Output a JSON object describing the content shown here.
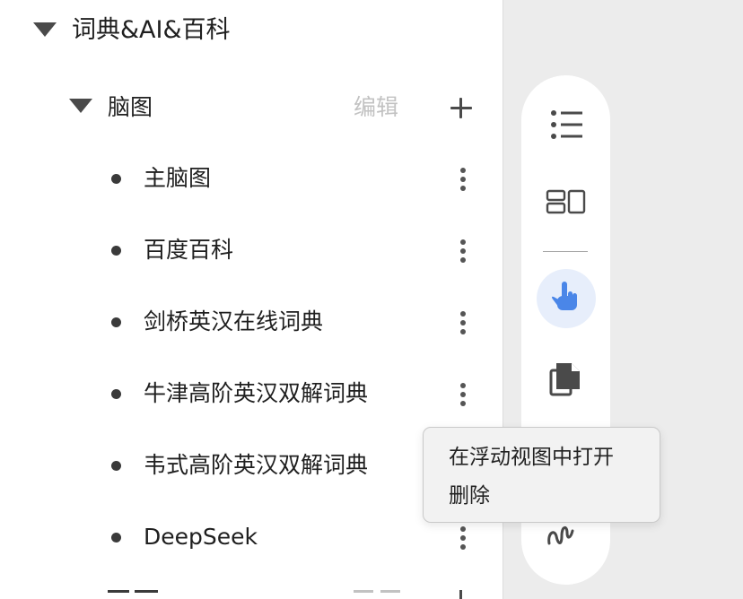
{
  "sidebar": {
    "group": {
      "title": "词典&AI&百科",
      "expanded": true
    },
    "subgroup": {
      "title": "脑图",
      "edit_label": "编辑",
      "expanded": true
    },
    "items": [
      {
        "label": "主脑图"
      },
      {
        "label": "百度百科"
      },
      {
        "label": "剑桥英汉在线词典"
      },
      {
        "label": "牛津高阶英汉双解词典"
      },
      {
        "label": "韦式高阶英汉双解词典"
      },
      {
        "label": "DeepSeek"
      }
    ]
  },
  "toolbar": {
    "tools": [
      "list-icon",
      "layout-icon",
      "pointer-hand-icon",
      "copy-icon",
      "draw-squiggle-icon"
    ],
    "active_tool": "pointer-hand-icon",
    "colors": {
      "active_bg": "#e7eefb",
      "active_icon": "#4a86e8",
      "icon": "#4a4a4a"
    }
  },
  "context_menu": {
    "items": [
      {
        "label": "在浮动视图中打开"
      },
      {
        "label": "删除"
      }
    ]
  }
}
